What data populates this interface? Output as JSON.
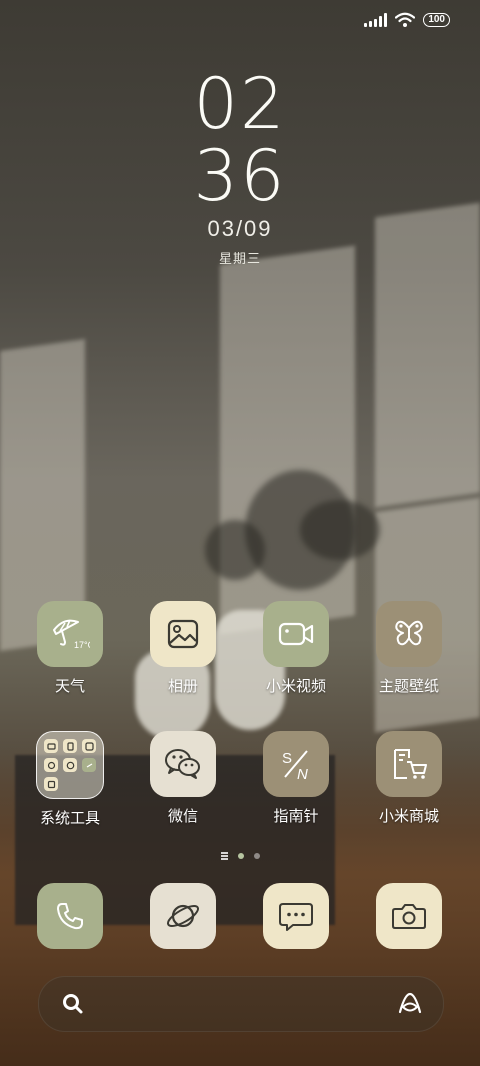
{
  "status_bar": {
    "battery": "100"
  },
  "clock": {
    "hour": "02",
    "minute": "36",
    "date": "03/09",
    "weekday": "星期三"
  },
  "apps_row1": [
    {
      "label": "天气",
      "icon": "umbrella-weather-icon",
      "icon_text": "17°C",
      "tile": "green"
    },
    {
      "label": "相册",
      "icon": "gallery-icon",
      "tile": "cream"
    },
    {
      "label": "小米视频",
      "icon": "video-camera-icon",
      "tile": "green"
    },
    {
      "label": "主题壁纸",
      "icon": "butterfly-theme-icon",
      "tile": "taupe"
    }
  ],
  "apps_row2": [
    {
      "label": "系统工具",
      "icon": "folder-icon",
      "tile": "folder"
    },
    {
      "label": "微信",
      "icon": "wechat-icon",
      "tile": "beige"
    },
    {
      "label": "指南针",
      "icon": "compass-icon",
      "icon_text_top": "S",
      "icon_text_bottom": "N",
      "tile": "taupe"
    },
    {
      "label": "小米商城",
      "icon": "shopping-cart-icon",
      "tile": "taupe"
    }
  ],
  "dock": [
    {
      "name": "phone",
      "icon": "phone-icon",
      "tile": "green"
    },
    {
      "name": "browser",
      "icon": "planet-browser-icon",
      "tile": "beige"
    },
    {
      "name": "messages",
      "icon": "message-bubble-icon",
      "tile": "cream"
    },
    {
      "name": "camera",
      "icon": "camera-icon",
      "tile": "cream"
    }
  ],
  "colors": {
    "green_tile": "#a8b08c",
    "cream_tile": "#efe6c8",
    "taupe_tile": "#9c9076",
    "beige_tile": "#e6e0d2",
    "icon_stroke": "#3b3a33"
  }
}
